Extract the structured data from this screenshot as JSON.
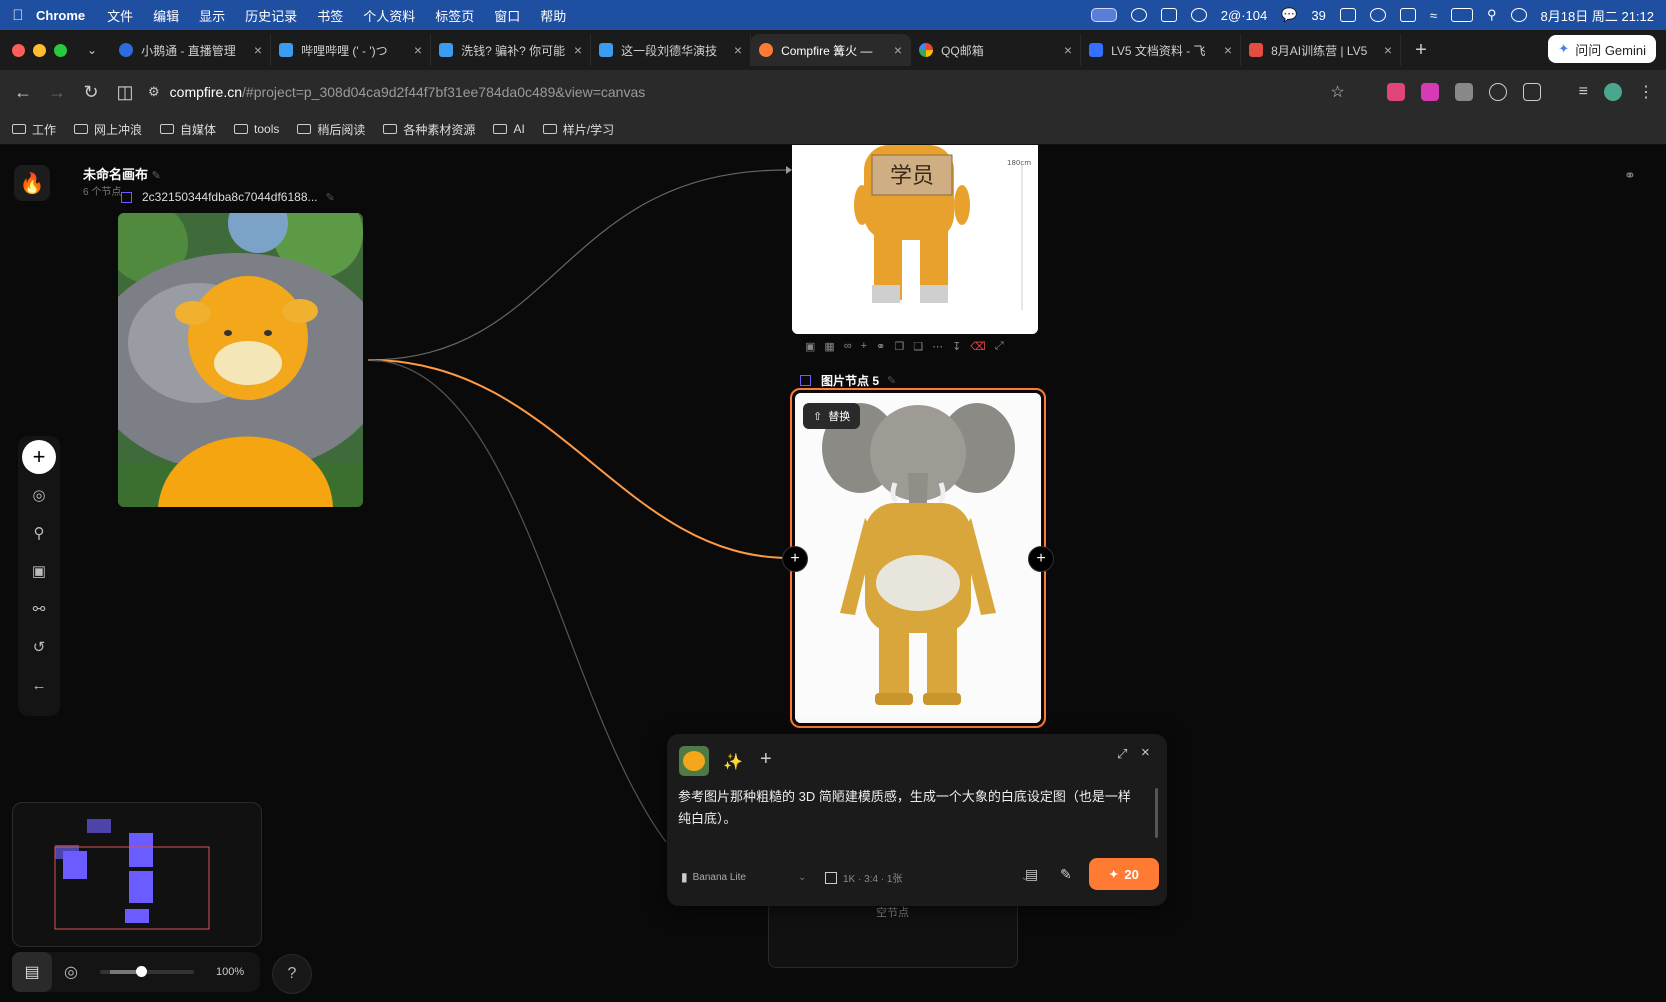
{
  "menubar": {
    "app": "Chrome",
    "items": [
      "文件",
      "编辑",
      "显示",
      "历史记录",
      "书签",
      "个人资料",
      "标签页",
      "窗口",
      "帮助"
    ],
    "status": {
      "notif": "2@·104",
      "wechat": "39",
      "datetime": "8月18日 周二  21:12"
    }
  },
  "tabs": [
    {
      "label": "小鹅通 - 直播管理",
      "color": "#2d6cdf"
    },
    {
      "label": "哔哩哔哩 (' - ')つ",
      "color": "#3b9df0"
    },
    {
      "label": "洗钱? 骗补? 你可能",
      "color": "#3b9df0"
    },
    {
      "label": "这一段刘德华演技",
      "color": "#3b9df0"
    },
    {
      "label": "Compfire 篝火 —",
      "color": "#ff7a33"
    },
    {
      "label": "QQ邮箱",
      "color": "#ea4335"
    },
    {
      "label": "LV5 文档资料 - 飞",
      "color": "#3370ff"
    },
    {
      "label": "8月AI训练营 | LV5",
      "color": "#e54d42"
    }
  ],
  "gemini_label": "问问 Gemini",
  "url": {
    "host": "compfire.cn",
    "path": "/#project=p_308d04ca9d2f44f7bf31ee784da0c489&view=canvas"
  },
  "bookmarks": [
    "工作",
    "网上冲浪",
    "自媒体",
    "tools",
    "稍后阅读",
    "各种素材资源",
    "AI",
    "样片/学习"
  ],
  "canvas": {
    "title": "未命名画布",
    "node_count": "6 个节点",
    "node1_label": "2c32150344fdba8c7044df6188...",
    "node5_label": "图片节点 5",
    "replace_label": "替换",
    "height_mark": "180cm",
    "sign_text": "学员",
    "empty_node_label": "空节点",
    "zoom": "100%"
  },
  "prompt": {
    "text": "参考图片那种粗糙的 3D 简陋建模质感，生成一个大象的白底设定图（也是一样纯白底）。",
    "model": "Banana Lite",
    "options": "1K · 3:4 · 1张",
    "cost": "20"
  }
}
